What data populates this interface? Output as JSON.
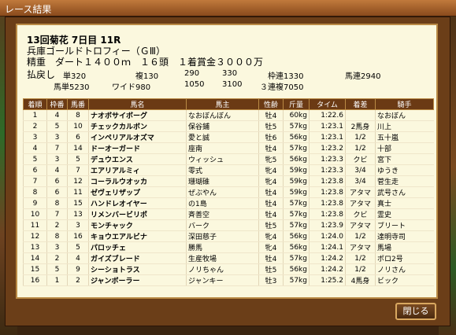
{
  "window": {
    "title": "レース結果"
  },
  "race": {
    "header": "13回菊花 7日目 11R",
    "name": "兵庫ゴールドトロフィー（ＧⅢ）",
    "conditions": "精重　ダート１４００ｍ　１６頭　１着賞金３０００万"
  },
  "payouts": {
    "label": "払戻し",
    "tansho": "単320",
    "fukusho_label": "複130",
    "fukusho_2": "290",
    "fukusho_3": "330",
    "wakuren": "枠連1330",
    "umaren": "馬連2940",
    "umatan": "馬単5230",
    "wide_label": "ワイド980",
    "wide_2": "1050",
    "wide_3": "3100",
    "sanrenpuku": "３連複7050"
  },
  "table": {
    "headers": [
      "着順",
      "枠番",
      "馬番",
      "馬名",
      "馬主",
      "性齢",
      "斤量",
      "タイム",
      "着差",
      "騎手"
    ],
    "rows": [
      [
        "1",
        "4",
        "8",
        "ナオボサイボーグ",
        "なおぼんぼん",
        "牡4",
        "60kg",
        "1:22.6",
        "",
        "なおぼん"
      ],
      [
        "2",
        "5",
        "10",
        "チェックカルボン",
        "保谷鋪",
        "牡5",
        "57kg",
        "1:23.1",
        "2馬身",
        "川上"
      ],
      [
        "3",
        "3",
        "6",
        "インペリアルオズマ",
        "愛と誠",
        "牡6",
        "56kg",
        "1:23.1",
        "1/2",
        "五十嵐"
      ],
      [
        "4",
        "7",
        "14",
        "ドーオーガード",
        "座南",
        "牡4",
        "57kg",
        "1:23.2",
        "1/2",
        "十部"
      ],
      [
        "5",
        "3",
        "5",
        "デュウエンス",
        "ウィッシュ",
        "牝5",
        "56kg",
        "1:23.3",
        "クビ",
        "宮下"
      ],
      [
        "6",
        "4",
        "7",
        "エアリアルミィ",
        "零式",
        "牝4",
        "59kg",
        "1:23.3",
        "3/4",
        "ゆうき"
      ],
      [
        "7",
        "6",
        "12",
        "コーラルウオッカ",
        "珊瑚碓",
        "牝4",
        "59kg",
        "1:23.8",
        "3/4",
        "菅生走"
      ],
      [
        "8",
        "6",
        "11",
        "ゼヴェリザップ",
        "ぜぶやん",
        "牡4",
        "59kg",
        "1:23.8",
        "アタマ",
        "武号さん"
      ],
      [
        "9",
        "8",
        "15",
        "ハンドレオイヤー",
        "の1島",
        "牡4",
        "57kg",
        "1:23.8",
        "アタマ",
        "真士"
      ],
      [
        "10",
        "7",
        "13",
        "リメンバービリポ",
        "斉善空",
        "牡4",
        "57kg",
        "1:23.8",
        "クビ",
        "霊史"
      ],
      [
        "11",
        "2",
        "3",
        "モンチャック",
        "バーク",
        "牡5",
        "57kg",
        "1:23.9",
        "アタマ",
        "ブリート"
      ],
      [
        "12",
        "8",
        "16",
        "キョウエアルビナ",
        "深田慈子",
        "牝4",
        "56kg",
        "1:24.0",
        "1/2",
        "達明寺司"
      ],
      [
        "13",
        "3",
        "5",
        "パロッチェ",
        "勝馬",
        "牝4",
        "56kg",
        "1:24.1",
        "アタマ",
        "馬場"
      ],
      [
        "14",
        "2",
        "4",
        "ガイズブレード",
        "生産牧場",
        "牡4",
        "57kg",
        "1:24.2",
        "1/2",
        "ポロ2号"
      ],
      [
        "15",
        "5",
        "9",
        "シーショトラス",
        "ノリちゃん",
        "牡5",
        "56kg",
        "1:24.2",
        "1/2",
        "ノリさん"
      ],
      [
        "16",
        "1",
        "2",
        "ジャンボーラー",
        "ジャンキー",
        "牡3",
        "57kg",
        "1:25.2",
        "4馬身",
        "ビック"
      ]
    ]
  },
  "buttons": {
    "close": "閉じる"
  },
  "colors": {
    "header_bg": "#6b3a14",
    "panel_bg": "#fbf8de",
    "name_color": "#000000"
  }
}
